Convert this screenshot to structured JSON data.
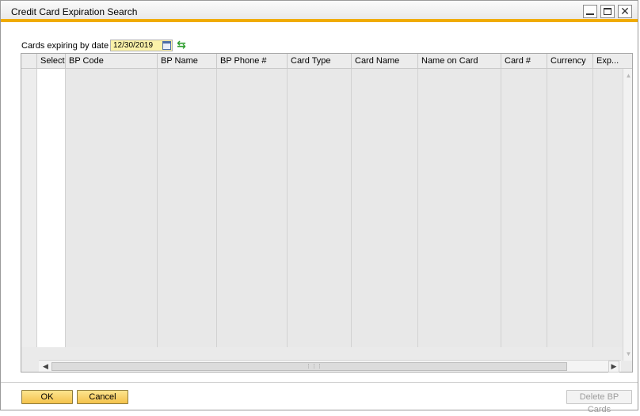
{
  "window": {
    "title": "Credit Card Expiration Search"
  },
  "filter": {
    "label": "Cards expiring by date",
    "date_value": "12/30/2019"
  },
  "grid": {
    "columns": [
      "Select",
      "BP Code",
      "BP Name",
      "BP Phone #",
      "Card Type",
      "Card Name",
      "Name on Card",
      "Card #",
      "Currency",
      "Exp..."
    ]
  },
  "buttons": {
    "ok": "OK",
    "cancel": "Cancel",
    "delete_bp_cards": "Delete BP Cards"
  },
  "icons": {
    "calendar": "calendar-icon",
    "refresh": "refresh-icon",
    "minimize": "minimize-icon",
    "maximize": "maximize-icon",
    "close": "close-icon"
  },
  "colors": {
    "accent": "#f0ab00",
    "button": "#f4c24c",
    "date_field": "#fbf2a9"
  }
}
